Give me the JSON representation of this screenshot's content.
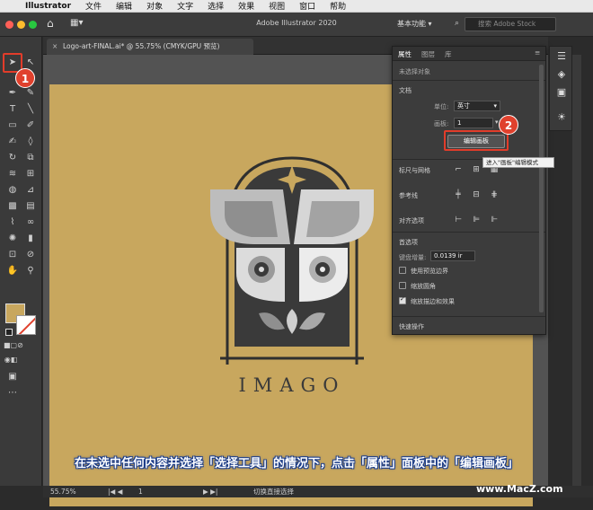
{
  "menubar": {
    "app": "Illustrator",
    "items": [
      "文件",
      "编辑",
      "对象",
      "文字",
      "选择",
      "效果",
      "视图",
      "窗口",
      "帮助"
    ]
  },
  "appbar": {
    "title": "Adobe Illustrator 2020",
    "workspace": "基本功能",
    "stock_placeholder": "搜索 Adobe Stock"
  },
  "document": {
    "tab_title": "Logo-art-FINAL.ai* @ 55.75% (CMYK/GPU 预览)",
    "logo_text": "IMAGO"
  },
  "panel": {
    "tabs": [
      "属性",
      "图层",
      "库"
    ],
    "no_selection": "未选择对象",
    "doc_header": "文档",
    "units_label": "单位:",
    "units_value": "英寸",
    "artboard_label": "画板:",
    "artboard_value": "1",
    "edit_artboards": "编辑画板",
    "rulers_grids": "标尺与网格",
    "guides": "参考线",
    "snap": "对齐选项",
    "prefs": "首选项",
    "keyboard_inc_label": "键盘增量:",
    "keyboard_inc_value": "0.0139 ir",
    "cb_preview_bounds": "使用预览边界",
    "cb_scale_corners": "缩放圆角",
    "cb_scale_strokes": "缩放描边和效果",
    "quick_actions": "快速操作"
  },
  "tooltip": "进入\"画板\"编辑模式",
  "badges": [
    "1",
    "2"
  ],
  "status": {
    "zoom": "55.75%",
    "page": "1",
    "tool": "切换直接选择"
  },
  "caption": "在未选中任何内容并选择「选择工具」的情况下，点击「属性」面板中的「编辑画板」",
  "watermark": "www.MacZ.com",
  "colors": {
    "artboard": "#c8a75e",
    "highlight": "#e23c2a",
    "fill_swatch": "#c8a75e"
  }
}
